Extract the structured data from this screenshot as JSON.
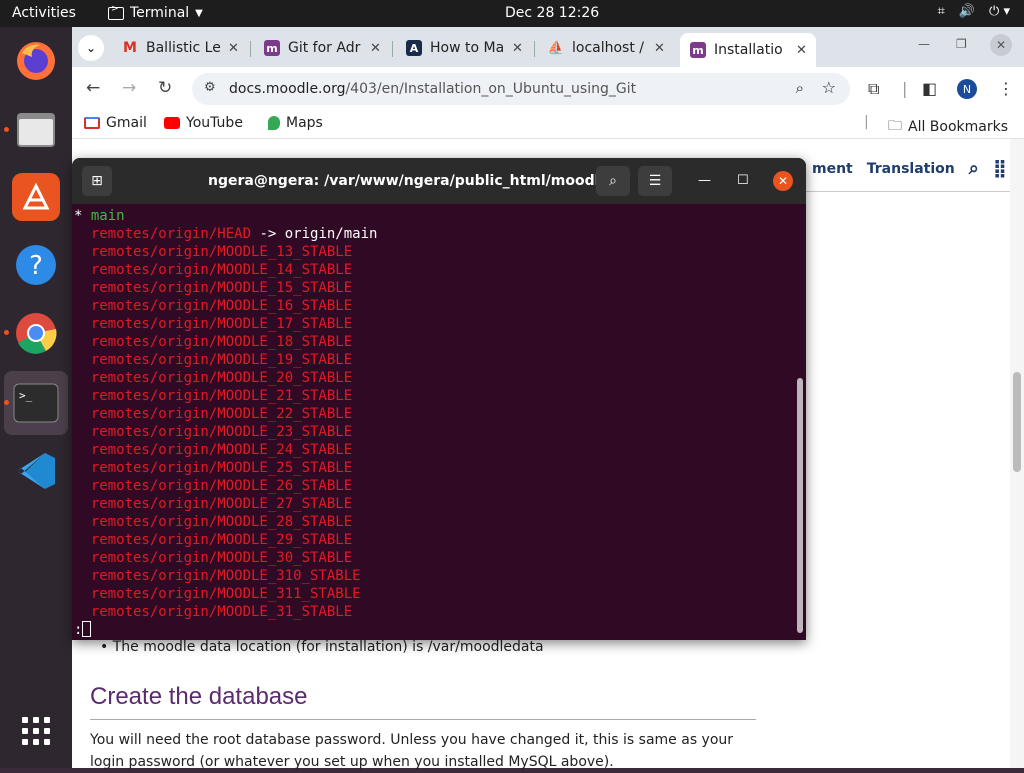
{
  "topbar": {
    "activities": "Activities",
    "app_name": "Terminal",
    "clock": "Dec 28  12:26"
  },
  "dock": {
    "apps": [
      "firefox-icon",
      "files-icon",
      "app-center-icon",
      "help-icon",
      "chrome-icon",
      "terminal-icon",
      "vscode-icon",
      "app-grid-icon"
    ]
  },
  "browser": {
    "tabs": [
      {
        "label": "Ballistic Le",
        "icon": "gmail-icon"
      },
      {
        "label": "Git for Adr",
        "icon": "moodle-icon"
      },
      {
        "label": "How to Ma",
        "icon": "devto-icon"
      },
      {
        "label": "localhost /",
        "icon": "phpmyadmin-icon"
      },
      {
        "label": "Installatio",
        "icon": "moodle-icon"
      }
    ],
    "url_host": "docs.moodle.org",
    "url_path": "/403/en/Installation_on_Ubuntu_using_Git",
    "avatar_letter": "N",
    "bookmarks": [
      "Gmail",
      "YouTube",
      "Maps"
    ],
    "all_bookmarks": "All Bookmarks"
  },
  "page": {
    "nav_partial": "ment",
    "nav_translation": "Translation",
    "bullet_text": "The moodle data location (for installation) is /var/moodledata",
    "heading": "Create the database",
    "paragraph": "You will need the root database password. Unless you have changed it, this is same as your login password (or whatever you set up when you installed MySQL above)."
  },
  "terminal": {
    "title": "ngera@ngera: /var/www/ngera/public_html/moodle",
    "current_branch": "main",
    "head_ref": "remotes/origin/HEAD",
    "head_arrow": " -> origin/main",
    "branches": [
      "remotes/origin/MOODLE_13_STABLE",
      "remotes/origin/MOODLE_14_STABLE",
      "remotes/origin/MOODLE_15_STABLE",
      "remotes/origin/MOODLE_16_STABLE",
      "remotes/origin/MOODLE_17_STABLE",
      "remotes/origin/MOODLE_18_STABLE",
      "remotes/origin/MOODLE_19_STABLE",
      "remotes/origin/MOODLE_20_STABLE",
      "remotes/origin/MOODLE_21_STABLE",
      "remotes/origin/MOODLE_22_STABLE",
      "remotes/origin/MOODLE_23_STABLE",
      "remotes/origin/MOODLE_24_STABLE",
      "remotes/origin/MOODLE_25_STABLE",
      "remotes/origin/MOODLE_26_STABLE",
      "remotes/origin/MOODLE_27_STABLE",
      "remotes/origin/MOODLE_28_STABLE",
      "remotes/origin/MOODLE_29_STABLE",
      "remotes/origin/MOODLE_30_STABLE",
      "remotes/origin/MOODLE_310_STABLE",
      "remotes/origin/MOODLE_311_STABLE",
      "remotes/origin/MOODLE_31_STABLE"
    ],
    "prompt": ":"
  }
}
